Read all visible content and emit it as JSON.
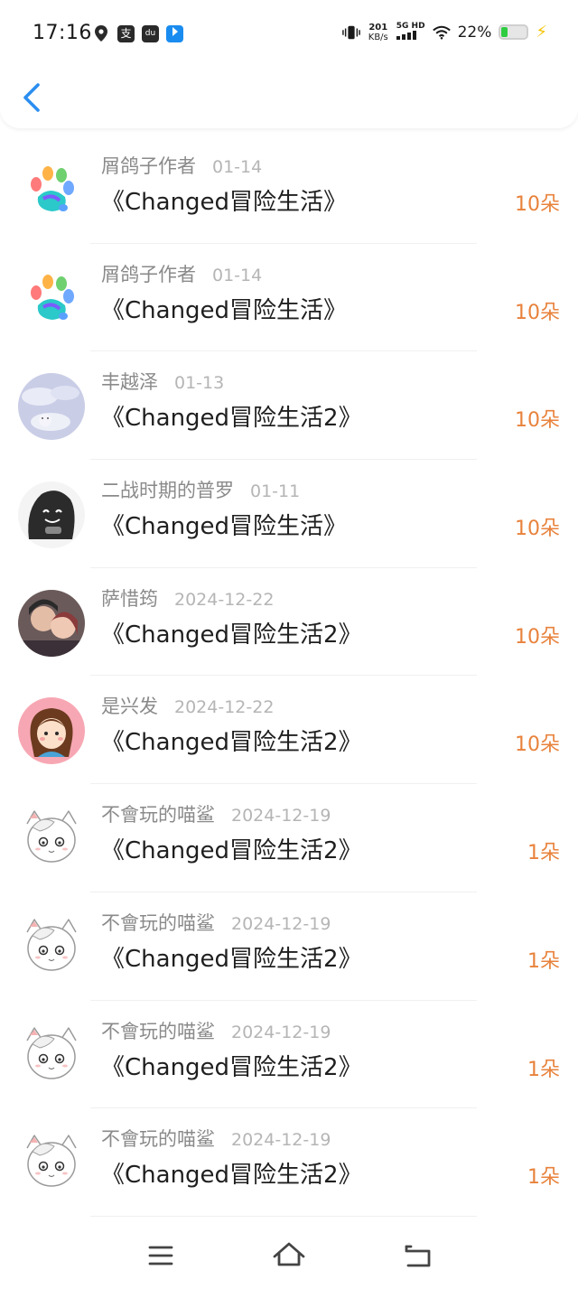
{
  "status_bar": {
    "time": "17:16",
    "net_speed_value": "201",
    "net_speed_unit": "KB/s",
    "network": "5G HD",
    "battery_percent": "22%",
    "battery_level": 0.22,
    "app_icon_1": "支",
    "app_icon_2": "du"
  },
  "header": {
    "back_icon": "chevron-left-icon"
  },
  "records": [
    {
      "name": "屑鸽子作者",
      "date": "01-14",
      "gift": "《Changed冒险生活》",
      "amount": "10朵",
      "avatar": "paw-avatar"
    },
    {
      "name": "屑鸽子作者",
      "date": "01-14",
      "gift": "《Changed冒险生活》",
      "amount": "10朵",
      "avatar": "paw-avatar"
    },
    {
      "name": "丰越泽",
      "date": "01-13",
      "gift": "《Changed冒险生活2》",
      "amount": "10朵",
      "avatar": "sky-avatar"
    },
    {
      "name": "二战时期的普罗",
      "date": "01-11",
      "gift": "《Changed冒险生活》",
      "amount": "10朵",
      "avatar": "dark-wolf-avatar"
    },
    {
      "name": "萨惜筠",
      "date": "2024-12-22",
      "gift": "《Changed冒险生活2》",
      "amount": "10朵",
      "avatar": "couple-photo-avatar"
    },
    {
      "name": "是兴发",
      "date": "2024-12-22",
      "gift": "《Changed冒险生活2》",
      "amount": "10朵",
      "avatar": "girl-avatar"
    },
    {
      "name": "不會玩的喵鲨",
      "date": "2024-12-19",
      "gift": "《Changed冒险生活2》",
      "amount": "1朵",
      "avatar": "white-cat-avatar"
    },
    {
      "name": "不會玩的喵鲨",
      "date": "2024-12-19",
      "gift": "《Changed冒险生活2》",
      "amount": "1朵",
      "avatar": "white-cat-avatar"
    },
    {
      "name": "不會玩的喵鲨",
      "date": "2024-12-19",
      "gift": "《Changed冒险生活2》",
      "amount": "1朵",
      "avatar": "white-cat-avatar"
    },
    {
      "name": "不會玩的喵鲨",
      "date": "2024-12-19",
      "gift": "《Changed冒险生活2》",
      "amount": "1朵",
      "avatar": "white-cat-avatar"
    }
  ],
  "navbar": {
    "menu_icon": "menu-icon",
    "home_icon": "home-icon",
    "back_icon": "back-icon"
  },
  "colors": {
    "accent_blue": "#2b8ef0",
    "amount_orange": "#e8823c",
    "name_gray": "#8a8a8a",
    "date_gray": "#b5b5b5"
  }
}
